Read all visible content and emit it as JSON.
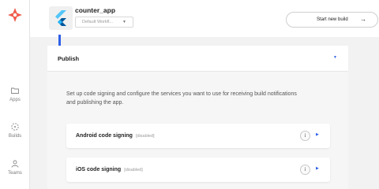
{
  "sidebar": {
    "items": [
      {
        "label": "Apps",
        "icon": "folder-icon"
      },
      {
        "label": "Builds",
        "icon": "builds-icon"
      },
      {
        "label": "Teams",
        "icon": "team-icon"
      }
    ],
    "accent_color": "#f05a4b"
  },
  "header": {
    "app_name": "counter_app",
    "workflow_value": "Default Workfl...",
    "start_build_label": "Start new build"
  },
  "publish": {
    "title": "Publish",
    "description": "Set up code signing and configure the services you want to use for receiving build notifications and publishing the app.",
    "rows": [
      {
        "label": "Android code signing",
        "status": "[disabled]"
      },
      {
        "label": "iOS code signing",
        "status": "[disabled]"
      }
    ]
  },
  "colors": {
    "accent_blue": "#2f60e8",
    "flutter_light": "#54c5f8",
    "flutter_dark": "#01579b"
  }
}
